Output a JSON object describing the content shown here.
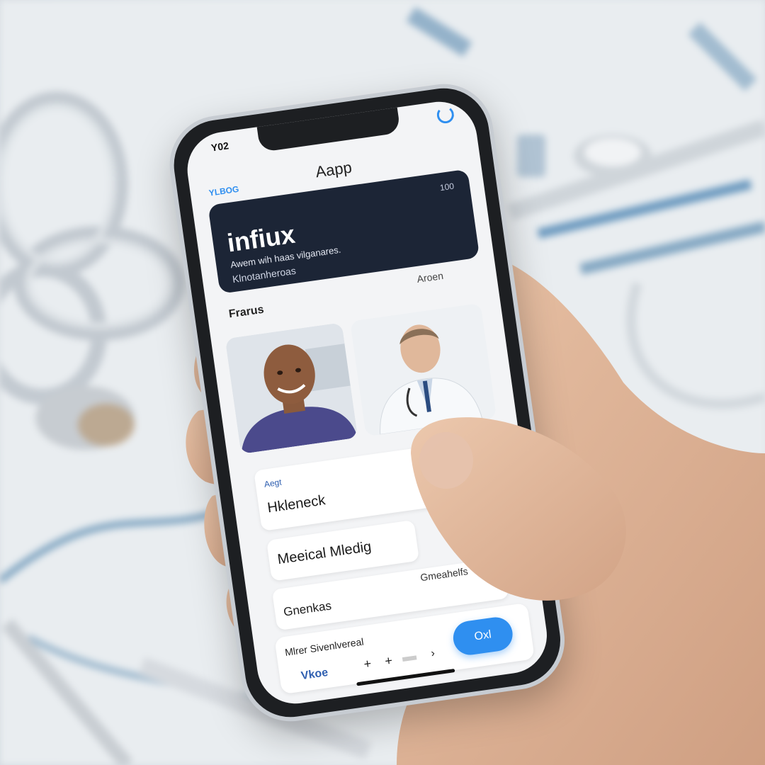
{
  "status_bar": {
    "time": "Y02",
    "top_right_icon": "wifi-icon"
  },
  "header": {
    "left_label": "YLBOG",
    "title": "Aapp"
  },
  "hero": {
    "badge": "100",
    "brand": "infiux",
    "tagline": "Awem wih haas vilganares.",
    "subline": "Klnotanheroas"
  },
  "section": {
    "title": "Frarus",
    "right_label": "Aroen"
  },
  "cards": [
    {
      "small_label": "Aegt",
      "title": "Hkleneck"
    },
    {
      "title": "Meeical Mledig"
    },
    {
      "title": "Gnenkas",
      "right_label": "Gmeahelfs"
    }
  ],
  "bottom": {
    "title": "Mlrer Sivenlvereal",
    "link": "Vkoe",
    "icons": [
      "plus-icon",
      "plus-icon",
      "minus-icon",
      "chevron-right-icon"
    ],
    "action_button": "Oxl"
  },
  "colors": {
    "accent": "#2f8ff0",
    "hero_bg": "#1c2536",
    "card_bg": "#ffffff"
  }
}
